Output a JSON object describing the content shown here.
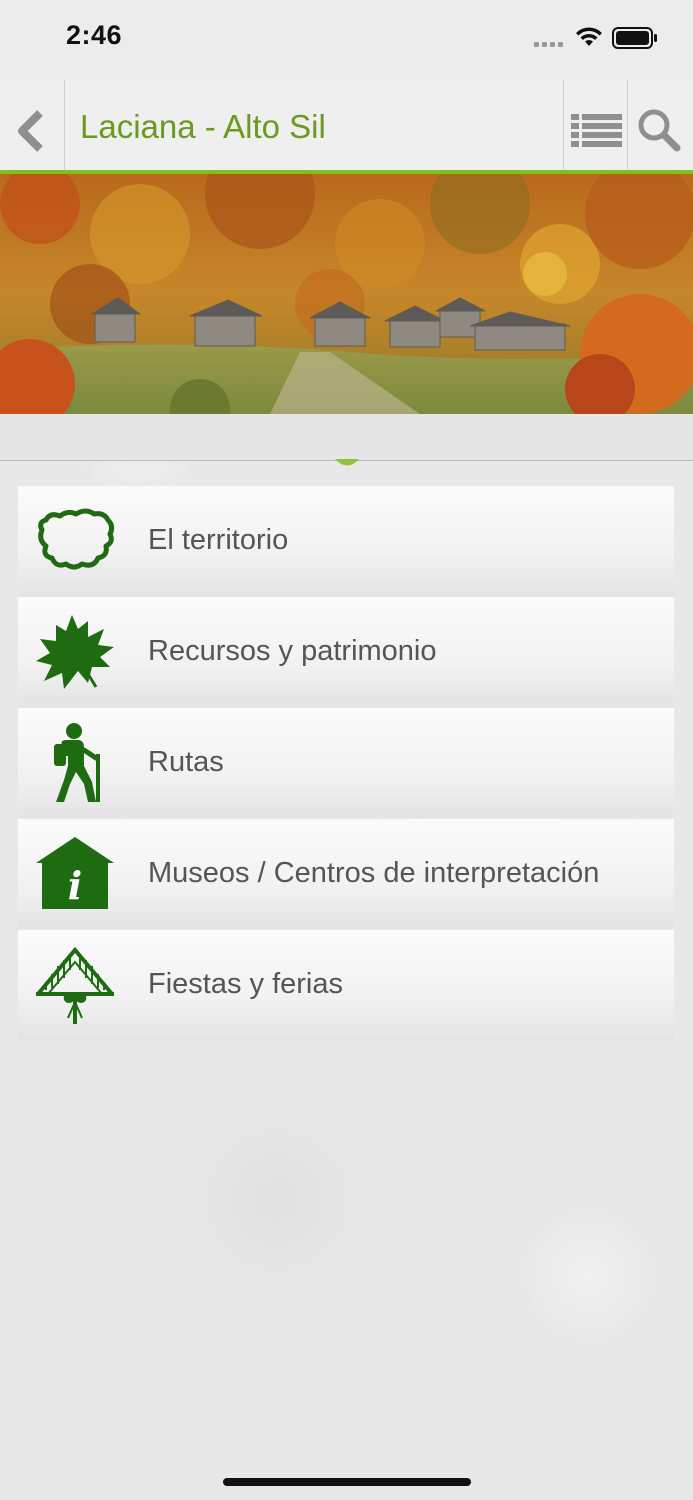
{
  "status_bar": {
    "time": "2:46"
  },
  "header": {
    "title": "Laciana - Alto Sil"
  },
  "colors": {
    "accent": "#6a9a1f",
    "icon_green": "#1e6b12",
    "nav_line": "#7fbf1e"
  },
  "menu": {
    "items": [
      {
        "label": "El territorio",
        "icon": "territory-map-icon"
      },
      {
        "label": "Recursos y patrimonio",
        "icon": "leaf-icon"
      },
      {
        "label": "Rutas",
        "icon": "hiker-icon"
      },
      {
        "label": "Museos / Centros de interpretación",
        "icon": "info-house-icon"
      },
      {
        "label": "Fiestas y ferias",
        "icon": "festival-arch-icon"
      }
    ]
  }
}
